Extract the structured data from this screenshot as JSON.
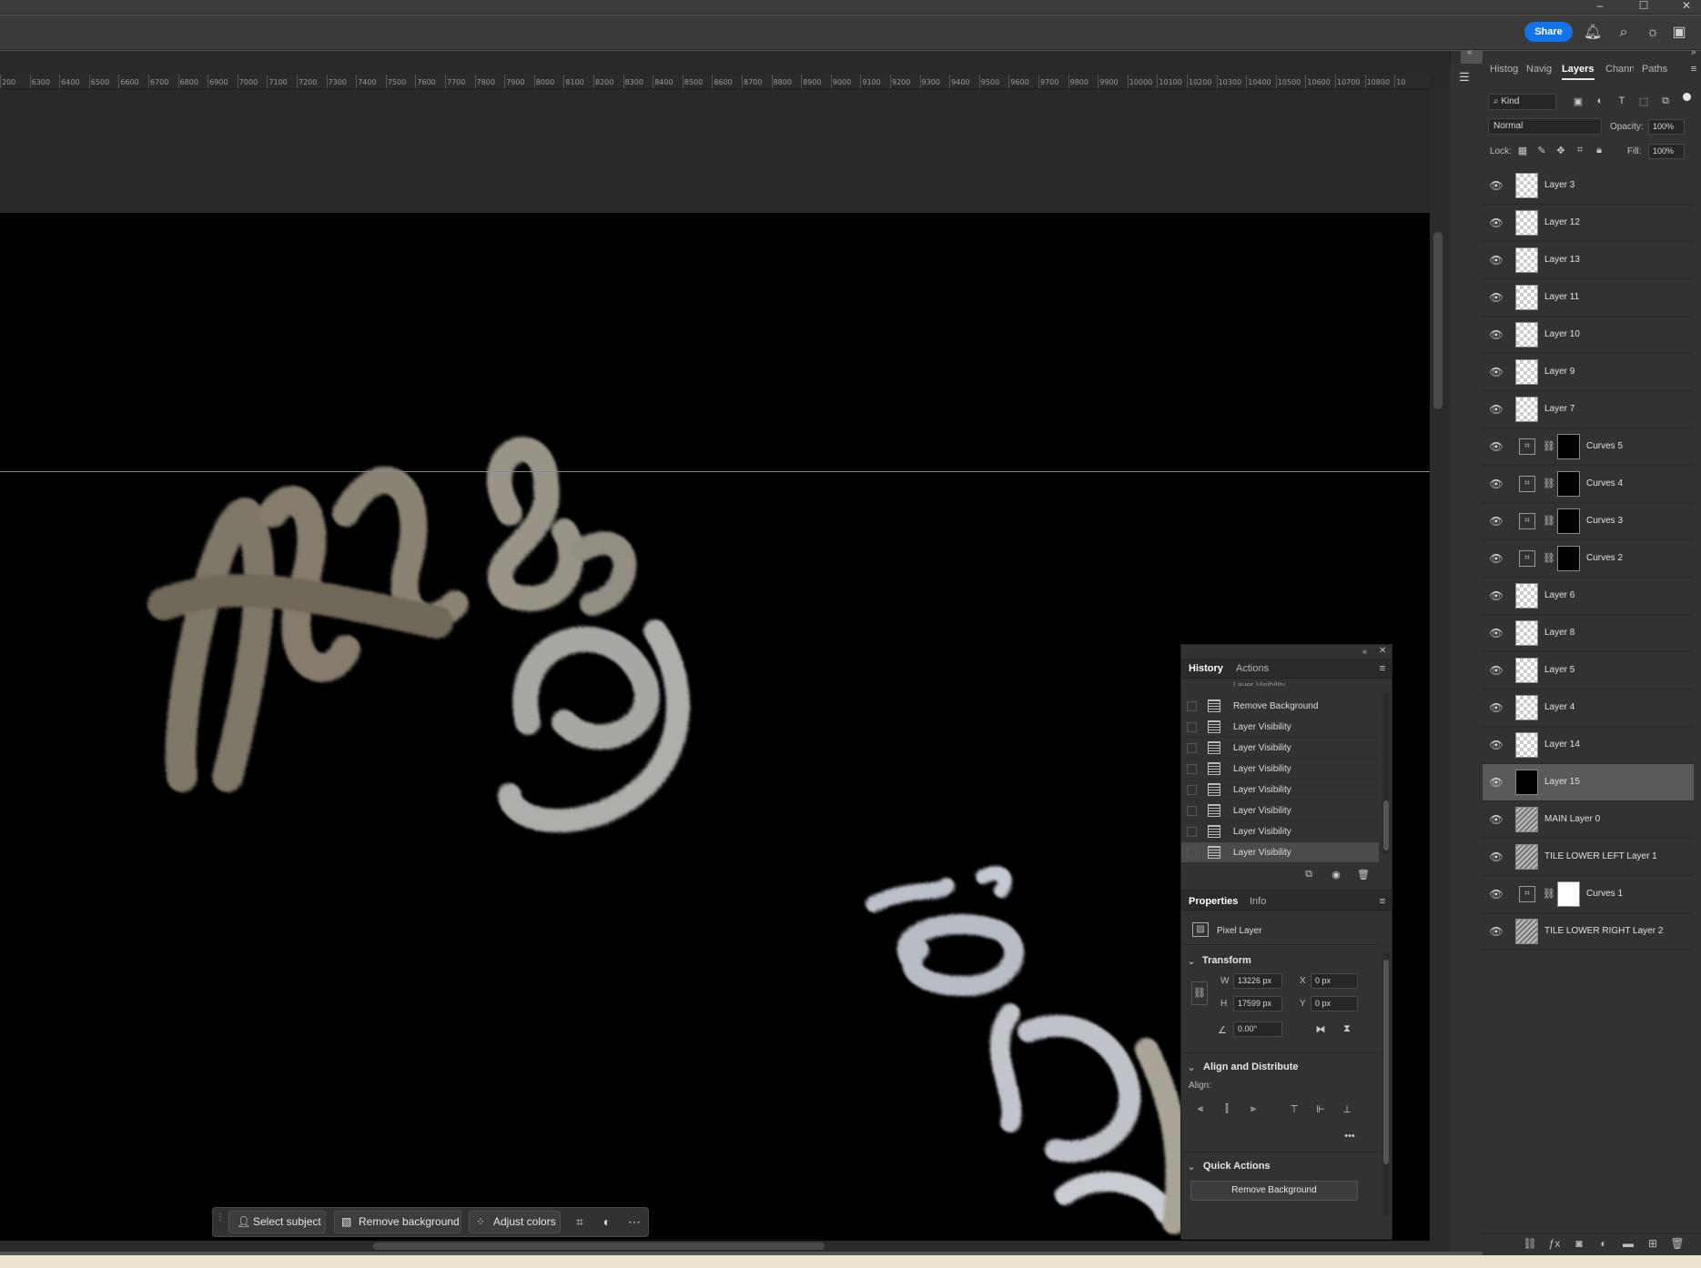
{
  "window": {
    "minimize": "–",
    "maximize": "☐",
    "close": "✕"
  },
  "options_bar": {
    "share_label": "Share"
  },
  "ruler_ticks": [
    "200",
    "6300",
    "6400",
    "6500",
    "6600",
    "6700",
    "6800",
    "6900",
    "7000",
    "7100",
    "7200",
    "7300",
    "7400",
    "7500",
    "7600",
    "7700",
    "7800",
    "7900",
    "8000",
    "8100",
    "8200",
    "8300",
    "8400",
    "8500",
    "8600",
    "8700",
    "8800",
    "8900",
    "9000",
    "9100",
    "9200",
    "9300",
    "9400",
    "9500",
    "9600",
    "9700",
    "9800",
    "9900",
    "10000",
    "10100",
    "10200",
    "10300",
    "10400",
    "10500",
    "10600",
    "10700",
    "10800",
    "10"
  ],
  "contextual_taskbar": {
    "select_subject": "Select subject",
    "remove_background": "Remove background",
    "adjust_colors": "Adjust colors"
  },
  "panel_tabs": [
    "Histog",
    "Navig",
    "Layers",
    "Chann",
    "Paths"
  ],
  "layers": {
    "filter_kind": "Kind",
    "blend_mode": "Normal",
    "opacity_label": "Opacity:",
    "opacity_value": "100%",
    "lock_label": "Lock:",
    "fill_label": "Fill:",
    "fill_value": "100%",
    "items": [
      {
        "name": "Layer 3",
        "kind": "pixel"
      },
      {
        "name": "Layer 12",
        "kind": "pixel"
      },
      {
        "name": "Layer 13",
        "kind": "pixel"
      },
      {
        "name": "Layer 11",
        "kind": "pixel"
      },
      {
        "name": "Layer 10",
        "kind": "pixel"
      },
      {
        "name": "Layer 9",
        "kind": "pixel"
      },
      {
        "name": "Layer 7",
        "kind": "pixel"
      },
      {
        "name": "Curves 5",
        "kind": "curves-black"
      },
      {
        "name": "Curves 4",
        "kind": "curves-black"
      },
      {
        "name": "Curves 3",
        "kind": "curves-black"
      },
      {
        "name": "Curves 2",
        "kind": "curves-black"
      },
      {
        "name": "Layer 6",
        "kind": "pixel"
      },
      {
        "name": "Layer 8",
        "kind": "pixel"
      },
      {
        "name": "Layer 5",
        "kind": "pixel"
      },
      {
        "name": "Layer 4",
        "kind": "pixel"
      },
      {
        "name": "Layer 14",
        "kind": "pixel"
      },
      {
        "name": "Layer 15",
        "kind": "black",
        "selected": true
      },
      {
        "name": "MAIN Layer 0",
        "kind": "pattern"
      },
      {
        "name": "TILE LOWER LEFT Layer 1",
        "kind": "pattern"
      },
      {
        "name": "Curves 1",
        "kind": "curves-white"
      },
      {
        "name": "TILE LOWER RIGHT Layer 2",
        "kind": "pattern"
      }
    ]
  },
  "history": {
    "tabs": [
      "History",
      "Actions"
    ],
    "partial_item": "Layer Visibility",
    "items": [
      "Remove Background",
      "Layer Visibility",
      "Layer Visibility",
      "Layer Visibility",
      "Layer Visibility",
      "Layer Visibility",
      "Layer Visibility",
      "Layer Visibility"
    ]
  },
  "properties": {
    "tabs": [
      "Properties",
      "Info"
    ],
    "layer_type": "Pixel Layer",
    "transform_title": "Transform",
    "w_label": "W",
    "w_value": "13226 px",
    "h_label": "H",
    "h_value": "17599 px",
    "x_label": "X",
    "x_value": "0 px",
    "y_label": "Y",
    "y_value": "0 px",
    "angle_value": "0.00°",
    "align_title": "Align and Distribute",
    "align_label": "Align:",
    "more": "•••",
    "quick_actions_title": "Quick Actions",
    "quick_action_button": "Remove Background"
  }
}
